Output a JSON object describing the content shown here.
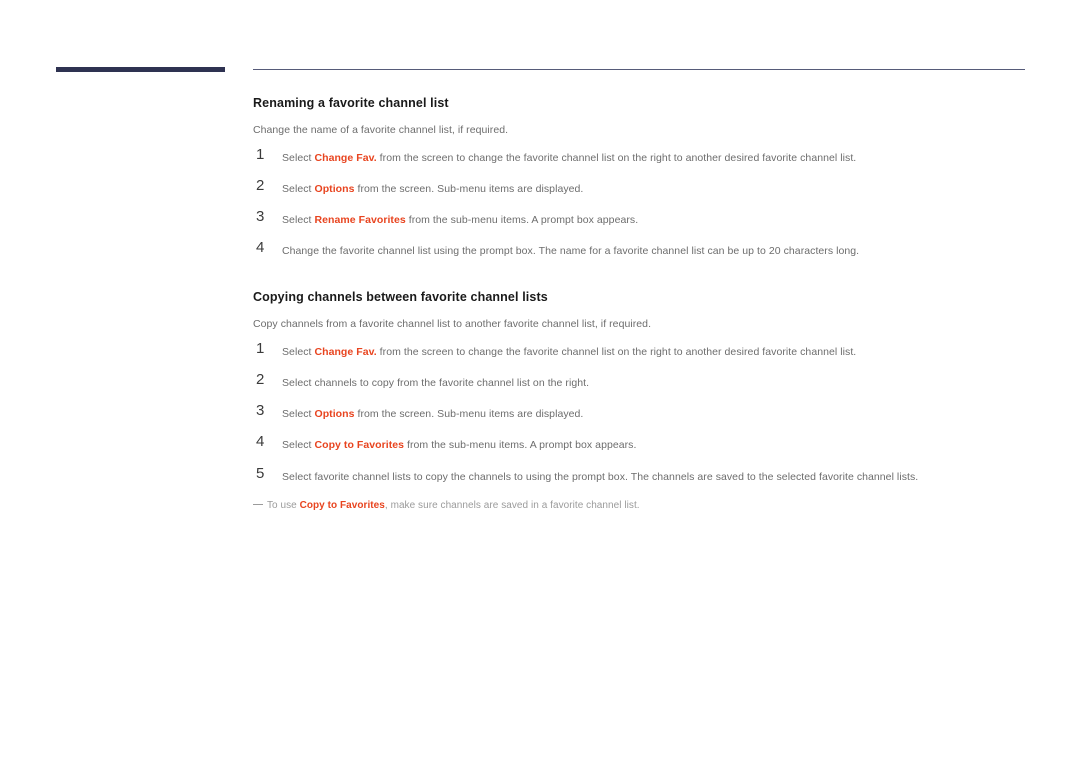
{
  "page": {
    "background_color": "#ffffff",
    "accent_color": "#e8441f",
    "header_bar_color": "#2e3251",
    "rule_color": "#565b79",
    "body_text_color": "#6d6d6d",
    "heading_text_color": "#1a1a1a",
    "note_text_color": "#9b9b9b"
  },
  "sections": [
    {
      "title": "Renaming a favorite channel list",
      "intro": "Change the name of a favorite channel list, if required.",
      "steps": [
        {
          "number": "1",
          "parts": [
            {
              "text": "Select ",
              "highlight": false
            },
            {
              "text": "Change Fav.",
              "highlight": true
            },
            {
              "text": " from the screen to change the favorite channel list on the right to another desired favorite channel list.",
              "highlight": false
            }
          ]
        },
        {
          "number": "2",
          "parts": [
            {
              "text": "Select ",
              "highlight": false
            },
            {
              "text": "Options",
              "highlight": true
            },
            {
              "text": " from the screen. Sub-menu items are displayed.",
              "highlight": false
            }
          ]
        },
        {
          "number": "3",
          "parts": [
            {
              "text": "Select ",
              "highlight": false
            },
            {
              "text": "Rename Favorites",
              "highlight": true
            },
            {
              "text": " from the sub-menu items. A prompt box appears.",
              "highlight": false
            }
          ]
        },
        {
          "number": "4",
          "parts": [
            {
              "text": "Change the favorite channel list using the prompt box. The name for a favorite channel list can be up to 20 characters long.",
              "highlight": false
            }
          ]
        }
      ],
      "note": null
    },
    {
      "title": "Copying channels between favorite channel lists",
      "intro": "Copy channels from a favorite channel list to another favorite channel list, if required.",
      "steps": [
        {
          "number": "1",
          "parts": [
            {
              "text": "Select ",
              "highlight": false
            },
            {
              "text": "Change Fav.",
              "highlight": true
            },
            {
              "text": " from the screen to change the favorite channel list on the right to another desired favorite channel list.",
              "highlight": false
            }
          ]
        },
        {
          "number": "2",
          "parts": [
            {
              "text": "Select channels to copy from the favorite channel list on the right.",
              "highlight": false
            }
          ]
        },
        {
          "number": "3",
          "parts": [
            {
              "text": "Select ",
              "highlight": false
            },
            {
              "text": "Options",
              "highlight": true
            },
            {
              "text": " from the screen. Sub-menu items are displayed.",
              "highlight": false
            }
          ]
        },
        {
          "number": "4",
          "parts": [
            {
              "text": "Select ",
              "highlight": false
            },
            {
              "text": "Copy to Favorites",
              "highlight": true
            },
            {
              "text": " from the sub-menu items. A prompt box appears.",
              "highlight": false
            }
          ]
        },
        {
          "number": "5",
          "parts": [
            {
              "text": "Select favorite channel lists to copy the channels to using the prompt box. The channels are saved to the selected favorite channel lists.",
              "highlight": false
            }
          ]
        }
      ],
      "note": {
        "parts": [
          {
            "text": "To use ",
            "highlight": false
          },
          {
            "text": "Copy to Favorites",
            "highlight": true
          },
          {
            "text": ", make sure channels are saved in a favorite channel list.",
            "highlight": false
          }
        ]
      }
    }
  ]
}
